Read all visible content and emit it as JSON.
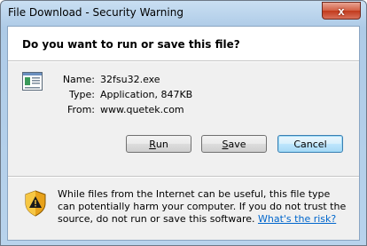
{
  "window": {
    "title": "File Download - Security Warning",
    "close_glyph": "x"
  },
  "dialog": {
    "question": "Do you want to run or save this file?",
    "file": {
      "name_label": "Name:",
      "name_value": "32fsu32.exe",
      "type_label": "Type:",
      "type_value": "Application, 847KB",
      "from_label": "From:",
      "from_value": "www.quetek.com"
    },
    "buttons": {
      "run": {
        "mnemonic": "R",
        "rest": "un"
      },
      "save": {
        "mnemonic": "S",
        "rest": "ave"
      },
      "cancel": {
        "label": "Cancel"
      }
    },
    "warning": {
      "text": "While files from the Internet can be useful, this file type can potentially harm your computer. If you do not trust the source, do not run or save this software. ",
      "link": "What's the risk?"
    }
  },
  "icons": {
    "file": "application-file-icon",
    "warning": "warning-shield-icon",
    "close": "close-icon"
  },
  "colors": {
    "link": "#0066cc",
    "close_button": "#c23a1c",
    "title_bar": "#b8d3ec"
  }
}
